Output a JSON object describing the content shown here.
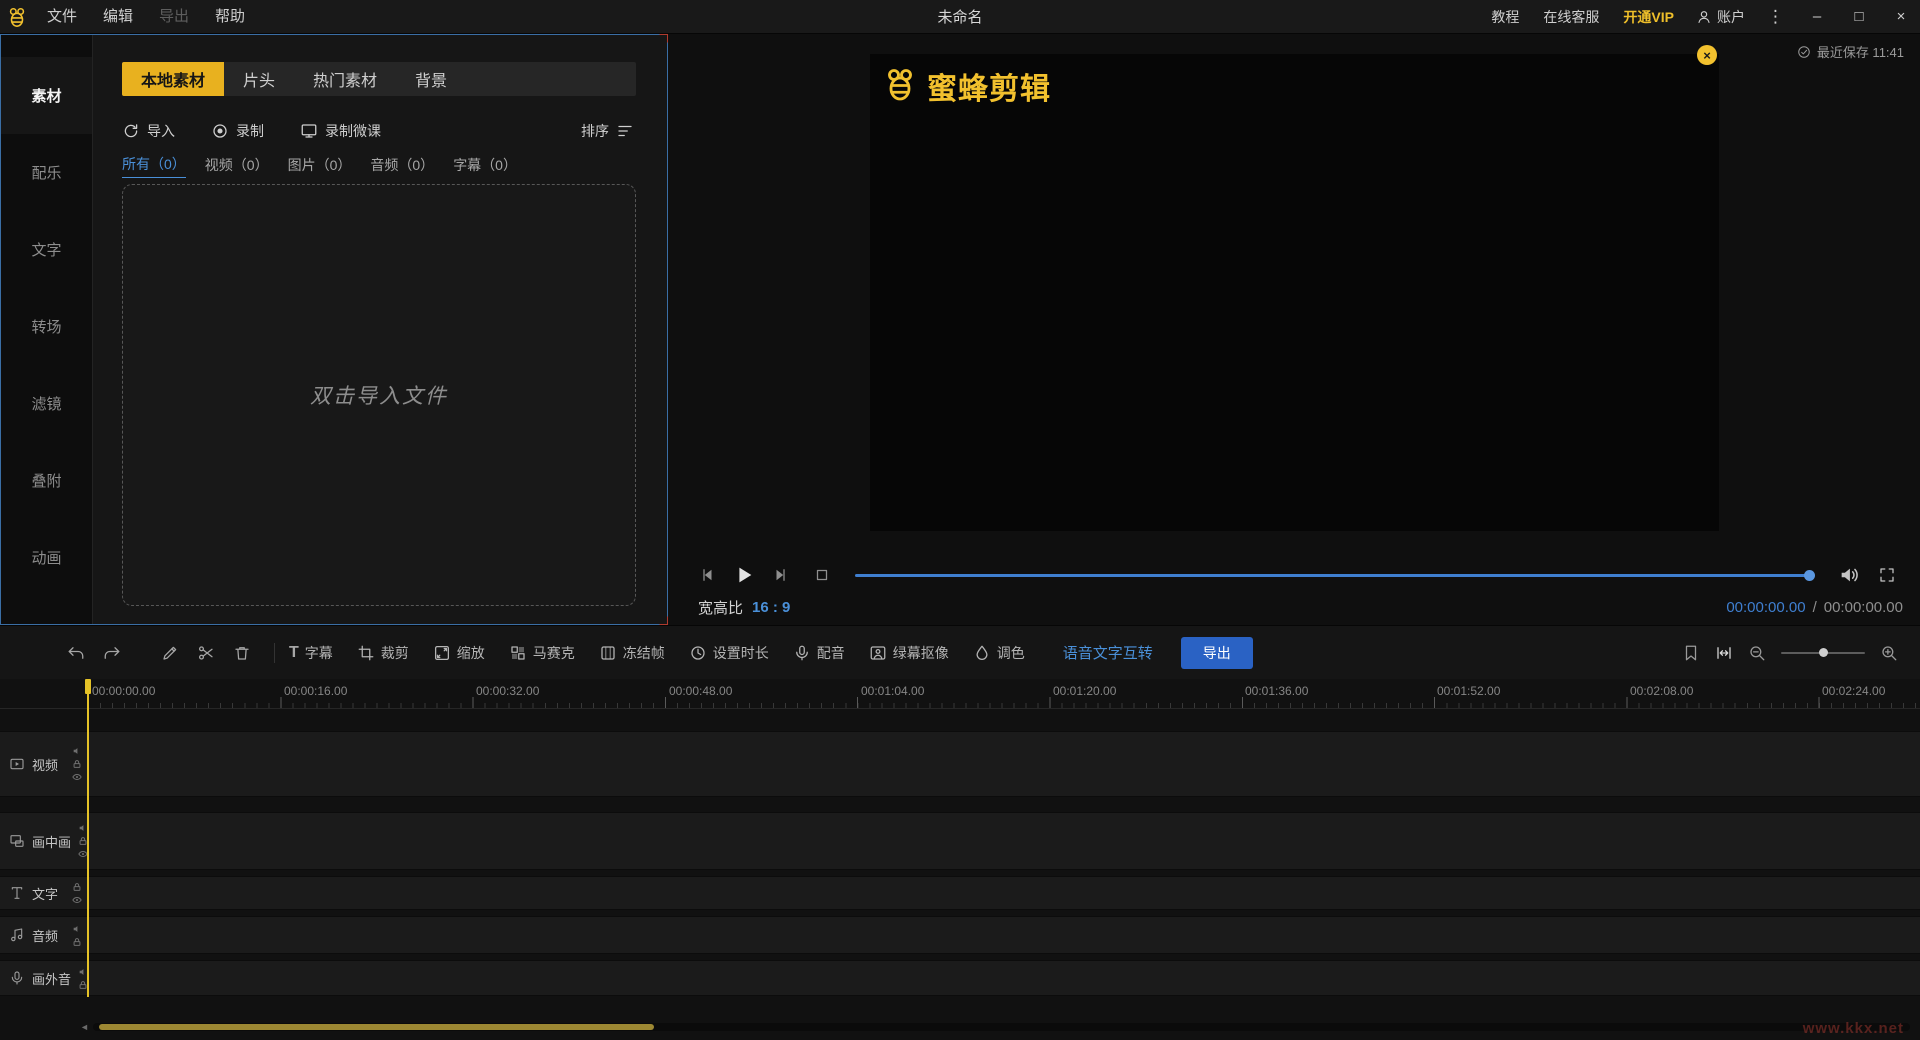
{
  "titlebar": {
    "menus": [
      "文件",
      "编辑",
      "导出",
      "帮助"
    ],
    "title": "未命名",
    "tutorial": "教程",
    "support": "在线客服",
    "vip": "开通VIP",
    "account": "账户"
  },
  "icons": {
    "more": "⋮",
    "minimize": "–",
    "maximize": "□",
    "close": "×",
    "video_close": "×",
    "scroll_left": "◄",
    "subtitle_glyph": "T"
  },
  "sidebar": {
    "items": [
      "素材",
      "配乐",
      "文字",
      "转场",
      "滤镜",
      "叠附",
      "动画"
    ]
  },
  "media": {
    "tabs": [
      "本地素材",
      "片头",
      "热门素材",
      "背景"
    ],
    "import_label": "导入",
    "record_label": "录制",
    "record_lesson_label": "录制微课",
    "sort_label": "排序",
    "filters": [
      "所有（0）",
      "视频（0）",
      "图片（0）",
      "音频（0）",
      "字幕（0）"
    ],
    "dropzone_hint": "双击导入文件"
  },
  "preview": {
    "save_status": "最近保存 11:41",
    "brand": "蜜蜂剪辑",
    "aspect_label": "宽高比",
    "aspect_value": "16 : 9",
    "time_current": "00:00:00.00",
    "time_separator": "/",
    "time_total": "00:00:00.00"
  },
  "toolbar": {
    "subtitle": "字幕",
    "crop": "裁剪",
    "scale": "缩放",
    "mosaic": "马赛克",
    "freeze": "冻结帧",
    "duration": "设置时长",
    "dub": "配音",
    "chroma": "绿幕抠像",
    "grade": "调色",
    "speech_to_text": "语音文字互转",
    "export": "导出"
  },
  "timeline": {
    "ruler": [
      "00:00:00.00",
      "00:00:16.00",
      "00:00:32.00",
      "00:00:48.00",
      "00:01:04.00",
      "00:01:20.00",
      "00:01:36.00",
      "00:01:52.00",
      "00:02:08.00",
      "00:02:24.00"
    ],
    "tracks": [
      "视频",
      "画中画",
      "文字",
      "音频",
      "画外音"
    ]
  },
  "watermark": "www.kkx.net",
  "colors": {
    "accent_yellow": "#e8b11f",
    "accent_blue": "#4a90d9",
    "export_blue": "#2a62c4",
    "playhead_yellow": "#e5c227"
  }
}
